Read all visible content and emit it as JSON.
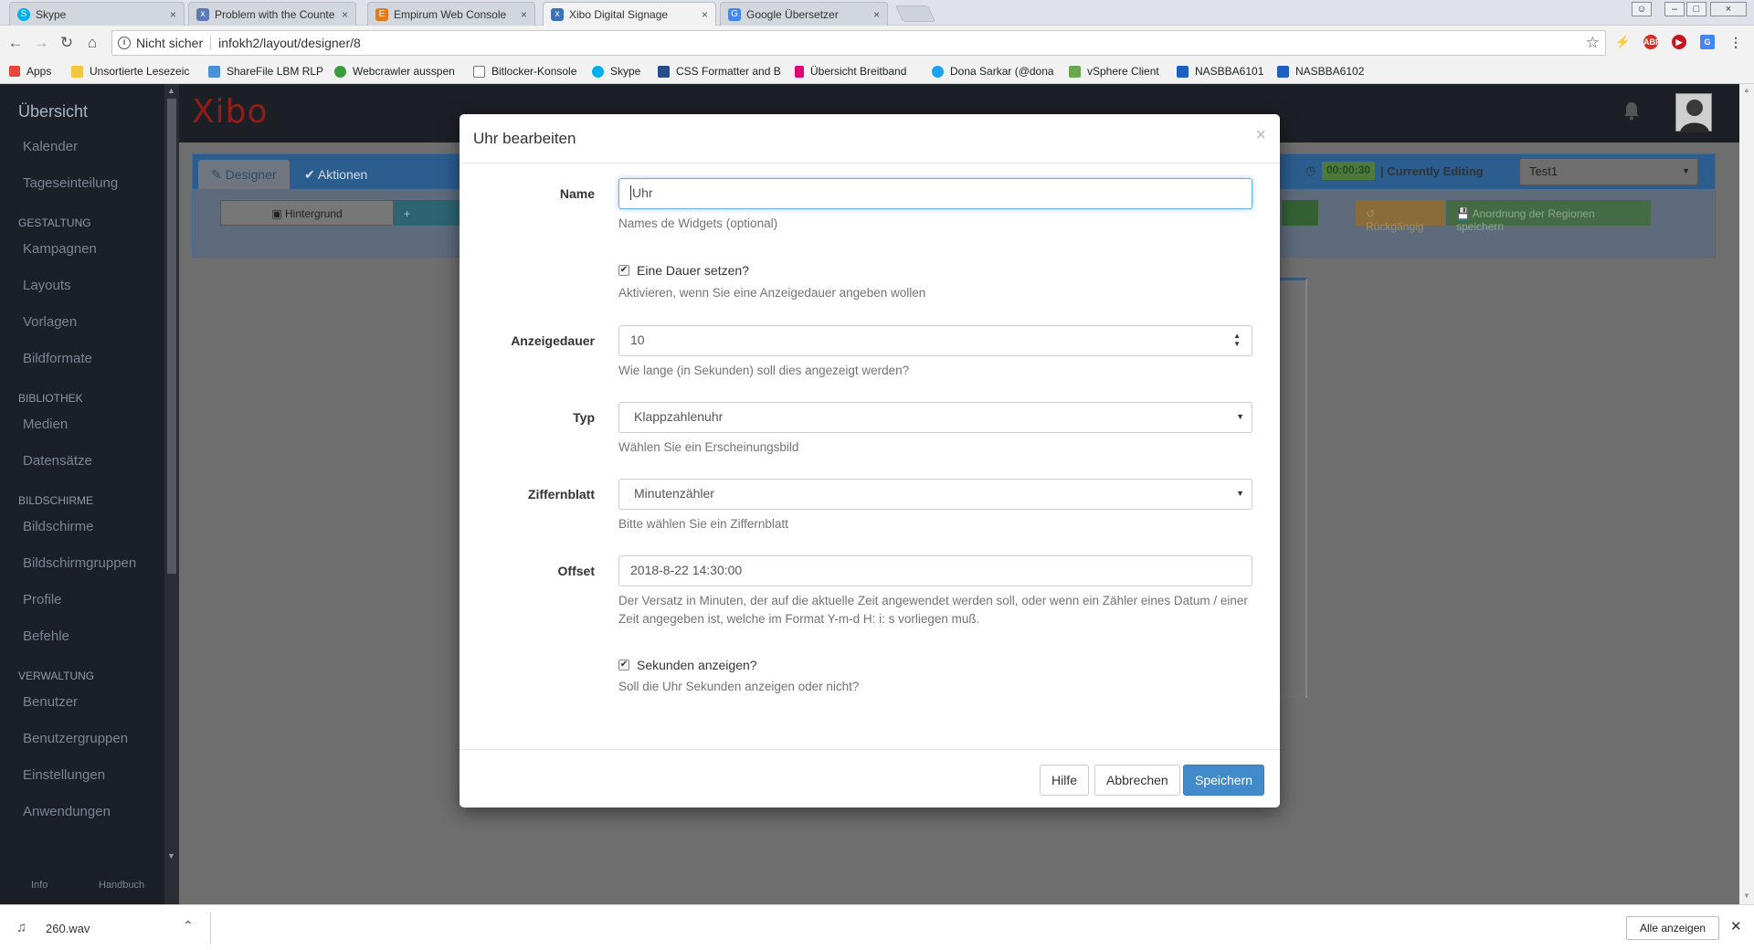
{
  "browser": {
    "tabs": [
      {
        "title": "Skype",
        "color": "#00aff0",
        "glyph": "S"
      },
      {
        "title": "Problem with the Counte",
        "color": "#5b7bb5",
        "glyph": "x"
      },
      {
        "title": "Empirum Web Console",
        "color": "#e07a1f",
        "glyph": "E"
      },
      {
        "title": "Xibo Digital Signage",
        "color": "#3b73b9",
        "glyph": "x"
      },
      {
        "title": "Google Übersetzer",
        "color": "#4285f4",
        "glyph": "G"
      }
    ],
    "tab_close": "×",
    "active_tab_index": 3,
    "window_buttons": [
      "☺",
      "–",
      "□",
      "×"
    ],
    "security_label": "Nicht sicher",
    "url": "infokh2/layout/designer/8",
    "bookmarks": [
      {
        "label": "Apps",
        "color": "#e8453c"
      },
      {
        "label": "Unsortierte Lesezeic",
        "color": "#f2c744"
      },
      {
        "label": "ShareFile LBM RLP",
        "color": "#4a90d9"
      },
      {
        "label": "Webcrawler ausspen",
        "color": "#3c9b3c"
      },
      {
        "label": "Bitlocker-Konsole",
        "color": "#ffffff"
      },
      {
        "label": "Skype",
        "color": "#00aff0"
      },
      {
        "label": "CSS Formatter and B",
        "color": "#2b4a8b"
      },
      {
        "label": "Übersicht Breitband",
        "color": "#e20074"
      },
      {
        "label": "Dona Sarkar (@dona",
        "color": "#1da1f2"
      },
      {
        "label": "vSphere Client",
        "color": "#6aa84f"
      },
      {
        "label": "NASBBA6101",
        "color": "#1f5fbf"
      },
      {
        "label": "NASBBA6102",
        "color": "#1f5fbf"
      }
    ]
  },
  "sidebar": {
    "title": "Übersicht",
    "entries": [
      {
        "type": "item",
        "label": "Kalender"
      },
      {
        "type": "item",
        "label": "Tageseinteilung"
      },
      {
        "type": "heading",
        "label": "GESTALTUNG"
      },
      {
        "type": "item",
        "label": "Kampagnen"
      },
      {
        "type": "item",
        "label": "Layouts"
      },
      {
        "type": "item",
        "label": "Vorlagen"
      },
      {
        "type": "item",
        "label": "Bildformate"
      },
      {
        "type": "heading",
        "label": "BIBLIOTHEK"
      },
      {
        "type": "item",
        "label": "Medien"
      },
      {
        "type": "item",
        "label": "Datensätze"
      },
      {
        "type": "heading",
        "label": "BILDSCHIRME"
      },
      {
        "type": "item",
        "label": "Bildschirme"
      },
      {
        "type": "item",
        "label": "Bildschirmgruppen"
      },
      {
        "type": "item",
        "label": "Profile"
      },
      {
        "type": "item",
        "label": "Befehle"
      },
      {
        "type": "heading",
        "label": "VERWALTUNG"
      },
      {
        "type": "item",
        "label": "Benutzer"
      },
      {
        "type": "item",
        "label": "Benutzergruppen"
      },
      {
        "type": "item",
        "label": "Einstellungen"
      },
      {
        "type": "item",
        "label": "Anwendungen"
      }
    ],
    "footer": {
      "info": "Info",
      "manual": "Handbuch"
    }
  },
  "topnav": {
    "logo": "Xibo"
  },
  "designer": {
    "tab_designer": "Designer",
    "tab_actions": "Aktionen",
    "timer": "00:00:30",
    "currently_editing": "Currently Editing",
    "layout_name": "Test1",
    "background_button": "Hintergrund",
    "undo_button": "Rückgängig",
    "save_regions_button": "Anordnung der Regionen speichern"
  },
  "modal": {
    "title": "Uhr bearbeiten",
    "close": "×",
    "name_label": "Name",
    "name_value": "Uhr",
    "name_help": "Names de Widgets (optional)",
    "duration_checkbox": "Eine Dauer setzen?",
    "duration_checked": "✔",
    "duration_checkbox_help": "Aktivieren, wenn Sie eine Anzeigedauer angeben wollen",
    "duration_label": "Anzeigedauer",
    "duration_value": "10",
    "duration_help": "Wie lange (in Sekunden) soll dies angezeigt werden?",
    "type_label": "Typ",
    "type_value": "Klappzahlenuhr",
    "type_help": "Wählen Sie ein Erscheinungsbild",
    "face_label": "Ziffernblatt",
    "face_value": "Minutenzähler",
    "face_help": "Bitte wählen Sie ein Ziffernblatt",
    "offset_label": "Offset",
    "offset_value": "2018-8-22 14:30:00",
    "offset_help": "Der Versatz in Minuten, der auf die aktuelle Zeit angewendet werden soll, oder wenn ein Zähler eines Datum / einer Zeit angegeben ist, welche im Format Y-m-d H: i: s vorliegen muß.",
    "seconds_checkbox": "Sekunden anzeigen?",
    "seconds_checked": "✔",
    "seconds_help": "Soll die Uhr Sekunden anzeigen oder nicht?",
    "help_button": "Hilfe",
    "cancel_button": "Abbrechen",
    "save_button": "Speichern"
  },
  "downloads": {
    "file": "260.wav",
    "show_all": "Alle anzeigen"
  }
}
